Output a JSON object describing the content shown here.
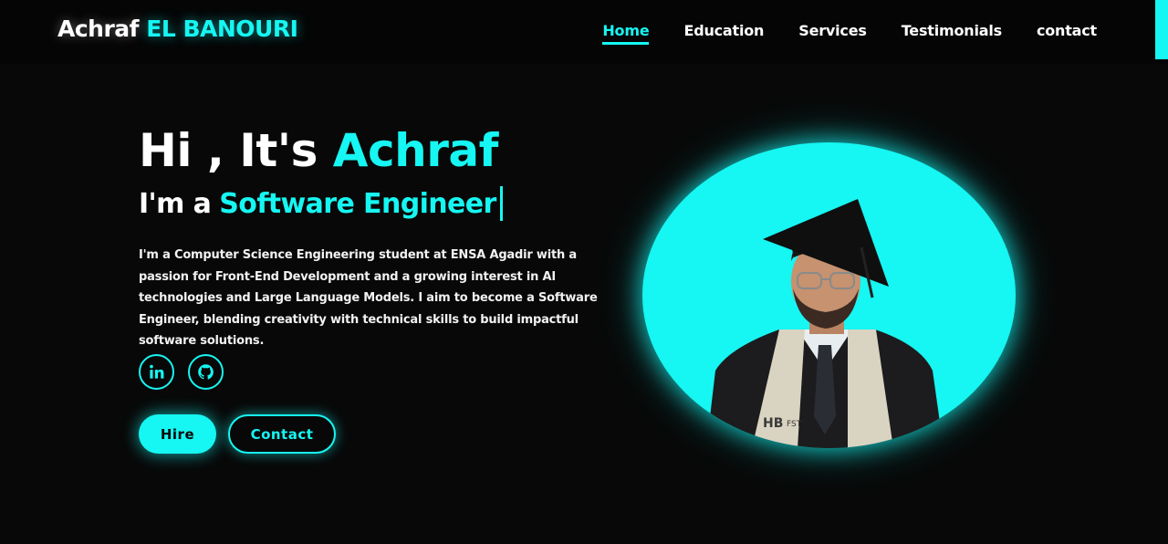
{
  "brand": {
    "first": "Achraf",
    "last": "EL BANOURI"
  },
  "nav": {
    "items": [
      {
        "label": "Home"
      },
      {
        "label": "Education"
      },
      {
        "label": "Services"
      },
      {
        "label": "Testimonials"
      },
      {
        "label": "contact"
      }
    ],
    "active": "Home"
  },
  "hero": {
    "greeting": "Hi , It's",
    "name": "Achraf",
    "role_prefix": "I'm a",
    "role": "Software Engineer",
    "description": "I'm a Computer Science Engineering student at ENSA Agadir with a passion for Front-End Development and a growing interest in AI technologies and Large Language Models. I aim to become a Software Engineer, blending creativity with technical skills to build impactful software solutions."
  },
  "social": [
    {
      "name": "linkedin",
      "icon": "linkedin-icon"
    },
    {
      "name": "github",
      "icon": "github-icon"
    }
  ],
  "buttons": {
    "hire": "Hire",
    "contact": "Contact"
  },
  "portrait": {
    "badge_text": "FST"
  },
  "colors": {
    "accent": "#16f6f2",
    "background": "#080808",
    "header": "#050505",
    "text": "#ffffff"
  }
}
